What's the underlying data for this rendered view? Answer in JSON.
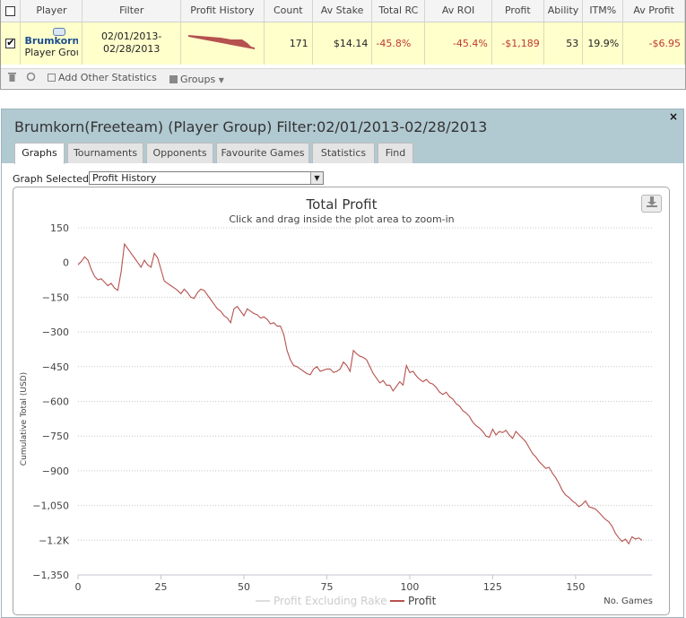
{
  "stats_table": {
    "headers": [
      "Player",
      "Filter",
      "Profit History",
      "Count",
      "Av Stake",
      "Total RC",
      "Av ROI",
      "Profit",
      "Ability",
      "ITM%",
      "Av Profit"
    ],
    "row": {
      "player_name": "Brumkorn(",
      "player_type": "Player Group",
      "filter_line1": "02/01/2013-",
      "filter_line2": "02/28/2013",
      "count": "171",
      "av_stake": "$14.14",
      "total_rc": "-45.8%",
      "av_roi": "-45.4%",
      "profit": "-$1,189",
      "ability": "53",
      "itm": "19.9%",
      "av_profit": "-$6.95"
    }
  },
  "toolbar": {
    "add_stats": "Add Other Statistics",
    "groups": "Groups"
  },
  "dialog": {
    "title": "Brumkorn(Freeteam) (Player Group) Filter:02/01/2013-02/28/2013",
    "close": "×",
    "tabs": [
      "Graphs",
      "Tournaments",
      "Opponents",
      "Favourite Games",
      "Statistics",
      "Find"
    ],
    "graph_selected_label": "Graph Selected:",
    "graph_selected_value": "Profit History"
  },
  "chart_data": {
    "type": "line",
    "title": "Total Profit",
    "subtitle": "Click and drag inside the plot area to zoom-in",
    "xlabel": "No. Games",
    "ylabel": "Cumulative Total (USD)",
    "xlim": [
      0,
      173
    ],
    "ylim": [
      -1350,
      150
    ],
    "x_ticks": [
      0,
      25,
      50,
      75,
      100,
      125,
      150
    ],
    "y_ticks": [
      150,
      0,
      -150,
      -300,
      -450,
      -600,
      -750,
      -900,
      -1050,
      -1200,
      -1350
    ],
    "y_tick_labels": [
      "150",
      "0",
      "−150",
      "−300",
      "−450",
      "−600",
      "−750",
      "−900",
      "−1,050",
      "−1.2K",
      "−1,350"
    ],
    "grid": "horizontal dotted",
    "legend_position": "bottom-center",
    "series": [
      {
        "name": "Profit Excluding Rake",
        "color": "#dddddd",
        "values": []
      },
      {
        "name": "Profit",
        "color": "#b5524f",
        "x": [
          0,
          1,
          2,
          3,
          4,
          5,
          6,
          7,
          8,
          9,
          10,
          11,
          12,
          13,
          14,
          15,
          16,
          17,
          18,
          19,
          20,
          21,
          22,
          23,
          24,
          25,
          26,
          27,
          28,
          29,
          30,
          31,
          32,
          33,
          34,
          35,
          36,
          37,
          38,
          39,
          40,
          41,
          42,
          43,
          44,
          45,
          46,
          47,
          48,
          49,
          50,
          51,
          52,
          53,
          54,
          55,
          56,
          57,
          58,
          59,
          60,
          61,
          62,
          63,
          64,
          65,
          66,
          67,
          68,
          69,
          70,
          71,
          72,
          73,
          74,
          75,
          76,
          77,
          78,
          79,
          80,
          81,
          82,
          83,
          84,
          85,
          86,
          87,
          88,
          89,
          90,
          91,
          92,
          93,
          94,
          95,
          96,
          97,
          98,
          99,
          100,
          101,
          102,
          103,
          104,
          105,
          106,
          107,
          108,
          109,
          110,
          111,
          112,
          113,
          114,
          115,
          116,
          117,
          118,
          119,
          120,
          121,
          122,
          123,
          124,
          125,
          126,
          127,
          128,
          129,
          130,
          131,
          132,
          133,
          134,
          135,
          136,
          137,
          138,
          139,
          140,
          141,
          142,
          143,
          144,
          145,
          146,
          147,
          148,
          149,
          150,
          151,
          152,
          153,
          154,
          155,
          156,
          157,
          158,
          159,
          160,
          161,
          162,
          163,
          164,
          165,
          166,
          167,
          168,
          169,
          170
        ],
        "values": [
          -10,
          5,
          25,
          10,
          -30,
          -60,
          -75,
          -70,
          -85,
          -100,
          -90,
          -110,
          -120,
          -40,
          80,
          60,
          40,
          20,
          0,
          -20,
          10,
          -10,
          -20,
          40,
          20,
          -30,
          -80,
          -90,
          -100,
          -110,
          -120,
          -135,
          -115,
          -130,
          -150,
          -155,
          -130,
          -115,
          -120,
          -140,
          -160,
          -180,
          -200,
          -210,
          -230,
          -240,
          -260,
          -200,
          -190,
          -210,
          -230,
          -200,
          -210,
          -220,
          -225,
          -240,
          -235,
          -245,
          -265,
          -260,
          -275,
          -275,
          -310,
          -380,
          -420,
          -445,
          -450,
          -460,
          -470,
          -480,
          -485,
          -460,
          -450,
          -470,
          -465,
          -460,
          -460,
          -475,
          -470,
          -460,
          -430,
          -445,
          -470,
          -380,
          -395,
          -405,
          -410,
          -420,
          -450,
          -480,
          -500,
          -520,
          -510,
          -530,
          -530,
          -555,
          -535,
          -515,
          -530,
          -445,
          -475,
          -470,
          -490,
          -505,
          -515,
          -505,
          -520,
          -525,
          -540,
          -560,
          -570,
          -560,
          -580,
          -590,
          -610,
          -620,
          -640,
          -650,
          -665,
          -690,
          -705,
          -715,
          -730,
          -750,
          -755,
          -720,
          -745,
          -730,
          -735,
          -725,
          -745,
          -760,
          -730,
          -745,
          -760,
          -775,
          -800,
          -825,
          -840,
          -860,
          -875,
          -890,
          -885,
          -910,
          -930,
          -955,
          -985,
          -1005,
          -1015,
          -1030,
          -1040,
          -1055,
          -1045,
          -1030,
          -1055,
          -1060,
          -1065,
          -1080,
          -1095,
          -1110,
          -1120,
          -1140,
          -1170,
          -1190,
          -1205,
          -1195,
          -1215,
          -1185,
          -1195,
          -1190,
          -1200
        ]
      }
    ]
  }
}
